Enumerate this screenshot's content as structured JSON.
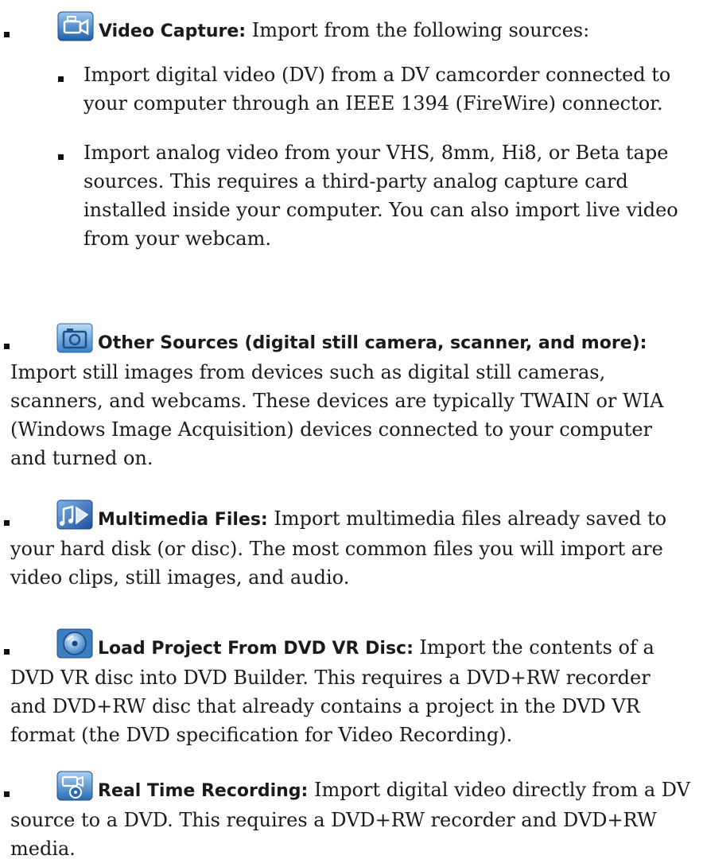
{
  "items": [
    {
      "icon": "video-capture-icon",
      "heading": "Video Capture:",
      "body": " Import from the following sources:",
      "subitems": [
        "Import digital video (DV) from a DV camcorder connected to your computer through an IEEE 1394 (FireWire) connector.",
        "Import analog video from your VHS, 8mm, Hi8, or Beta tape sources. This requires a third-party analog capture card installed inside your computer. You can also import live video from your webcam."
      ]
    },
    {
      "icon": "camera-icon",
      "heading": "Other Sources (digital still camera, scanner, and more):",
      "body": " Import still images from devices such as digital still cameras, scanners, and webcams. These devices are typically TWAIN or WIA (Windows Image Acquisition) devices connected to your computer and turned on."
    },
    {
      "icon": "multimedia-files-icon",
      "heading": "Multimedia Files:",
      "body": " Import multimedia files already saved to your hard disk (or disc). The most common files you will import are video clips, still images, and audio."
    },
    {
      "icon": "dvd-disc-icon",
      "heading": "Load Project From DVD VR Disc:",
      "body": " Import the contents of a DVD VR disc into DVD Builder. This requires a DVD+RW recorder and DVD+RW disc that already contains a project in the DVD VR format (the DVD specification for Video Recording)."
    },
    {
      "icon": "real-time-recording-icon",
      "heading": "Real Time Recording:",
      "body": " Import digital video directly from a DV source to a DVD. This requires a DVD+RW recorder and DVD+RW media."
    }
  ]
}
